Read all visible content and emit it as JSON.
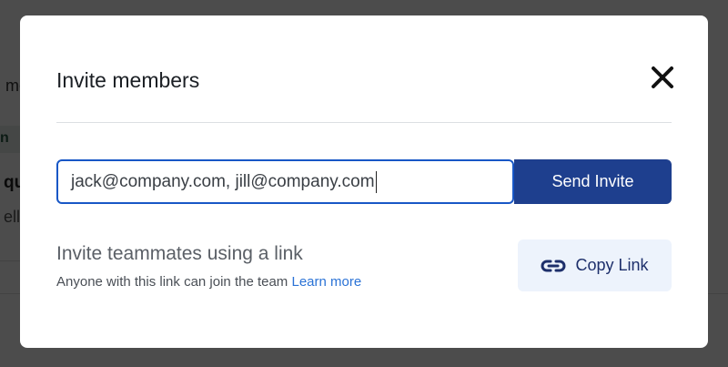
{
  "background": {
    "fragments": [
      "me",
      "n",
      "qu",
      "ello"
    ]
  },
  "modal": {
    "title": "Invite members",
    "close_icon": "close-icon",
    "email_input": {
      "value": "jack@company.com, jill@company.com",
      "placeholder": ""
    },
    "send_label": "Send Invite",
    "link_section": {
      "heading": "Invite teammates using a link",
      "description": "Anyone with this link can join the team",
      "learn_more": "Learn more",
      "copy_label": "Copy Link",
      "copy_icon": "link-icon"
    }
  },
  "colors": {
    "accent": "#1e3f8e",
    "focus_border": "#1857c6",
    "link": "#2b73d6",
    "copy_button_bg": "#edf3fc"
  }
}
